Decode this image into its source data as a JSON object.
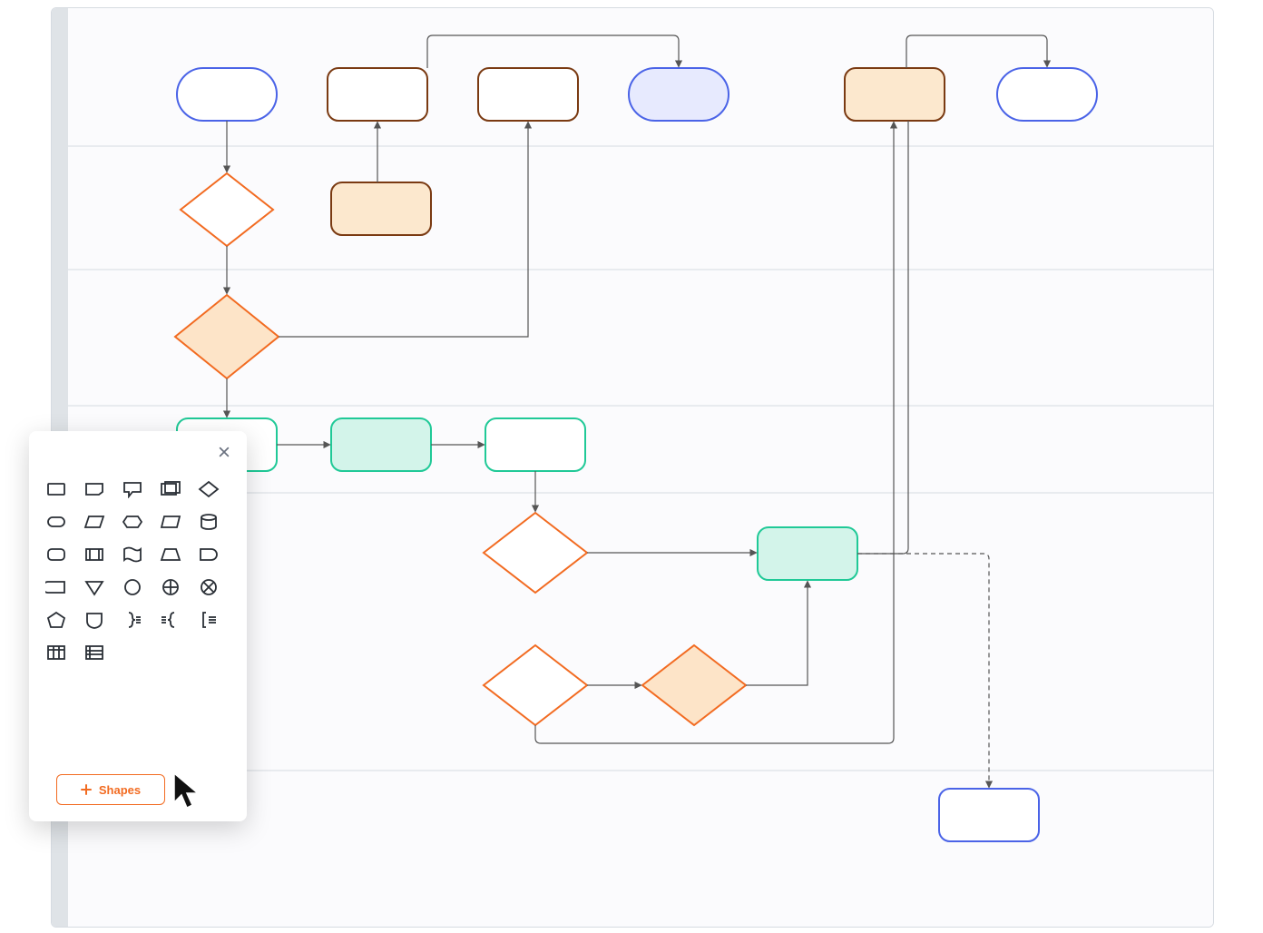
{
  "colors": {
    "blue": "#4a63e7",
    "blue_fill": "#e7eafe",
    "brown": "#7a3a12",
    "brown_fill": "#fce8ce",
    "orange": "#f26b21",
    "orange_fill": "#fde4c8",
    "teal": "#20c997",
    "teal_fill": "#d3f4ea"
  },
  "shapes_panel": {
    "close_tooltip": "Close",
    "add_button_label": "Shapes",
    "icons": [
      "rectangle-icon",
      "note-icon",
      "callout-icon",
      "group-box-icon",
      "diamond-icon",
      "terminator-icon",
      "parallelogram-icon",
      "hexagon-icon",
      "rhomboid-icon",
      "cylinder-icon",
      "rounded-rect-icon",
      "double-box-icon",
      "flag-icon",
      "trapezoid-icon",
      "dshape-icon",
      "half-round-icon",
      "triangle-down-icon",
      "circle-icon",
      "circle-plus-icon",
      "circle-x-icon",
      "pentagon-icon",
      "shield-icon",
      "brace-right-icon",
      "brace-mid-icon",
      "bracket-icon",
      "swimlane-v-icon",
      "swimlane-h-icon"
    ]
  },
  "swimlanes": {
    "count": 6
  },
  "diagram": {
    "description": "Cross-functional flowchart with six horizontal swimlanes and colored process/decision/terminator shapes connected by arrows."
  }
}
